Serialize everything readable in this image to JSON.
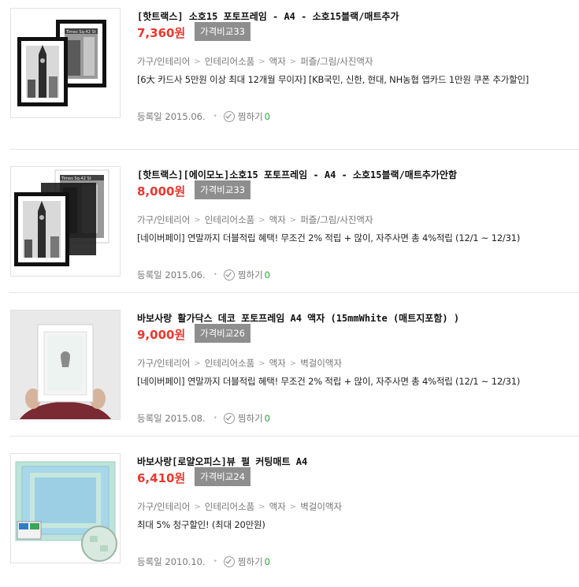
{
  "products": [
    {
      "title": "[핫트랙스] 소호15 포토프레임 - A4 - 소호15블랙/매트추가",
      "price": "7,360원",
      "compare_label": "가격비교33",
      "categories": [
        "가구/인테리어",
        "인테리어소품",
        "액자",
        "퍼즐/그림/사진액자"
      ],
      "promo": "[6大 카드사 5만원 이상 최대 12개월 무이자] [KB국민, 신한, 현대, NH농협 앱카드 1만원 쿠폰 추가할인]",
      "reg_date": "등록일 2015.06.",
      "zzim_label": "찜하기",
      "zzim_count": "0",
      "image": {
        "type": "frames",
        "photo_text": "Times Sq-42 St"
      }
    },
    {
      "title": "[핫트랙스][에이모노]소호15 포토프레임 - A4 - 소호15블랙/매트추가안함",
      "price": "8,000원",
      "compare_label": "가격비교33",
      "categories": [
        "가구/인테리어",
        "인테리어소품",
        "액자",
        "퍼즐/그림/사진액자"
      ],
      "promo": "[네이버페이] 연말까지 더블적립 혜택! 무조건 2% 적립 + 많이, 자주사면 총 4%적립 (12/1 ~ 12/31)",
      "reg_date": "등록일 2015.06.",
      "zzim_label": "찜하기",
      "zzim_count": "0",
      "image": {
        "type": "frames",
        "photo_text": "Times Sq-42 St"
      }
    },
    {
      "title": "바보사랑 활가닥스 데코 포토프레임 A4 액자 (15mmWhite (매트지포함) )",
      "price": "9,000원",
      "compare_label": "가격비교26",
      "categories": [
        "가구/인테리어",
        "인테리어소품",
        "액자",
        "벽걸이액자"
      ],
      "promo": "[네이버페이] 연말까지 더블적립 혜택! 무조건 2% 적립 + 많이, 자주사면 총 4%적립 (12/1 ~ 12/31)",
      "reg_date": "등록일 2015.08.",
      "zzim_label": "찜하기",
      "zzim_count": "0",
      "image": {
        "type": "held-frame"
      }
    },
    {
      "title": "바보사랑[로얄오피스]뷰 펄 커팅매트 A4",
      "price": "6,410원",
      "compare_label": "가격비교24",
      "categories": [
        "가구/인테리어",
        "인테리어소품",
        "액자",
        "벽걸이액자"
      ],
      "promo": "최대 5% 청구할인! (최대 20만원)",
      "reg_date": "등록일 2010.10.",
      "zzim_label": "찜하기",
      "zzim_count": "0",
      "image": {
        "type": "cutting-mat"
      }
    }
  ],
  "colors": {
    "price": "#e8382f",
    "compare_bg": "#8e8e8e",
    "zzim_count": "#2aa43b",
    "divider": "#e6e6e6"
  }
}
